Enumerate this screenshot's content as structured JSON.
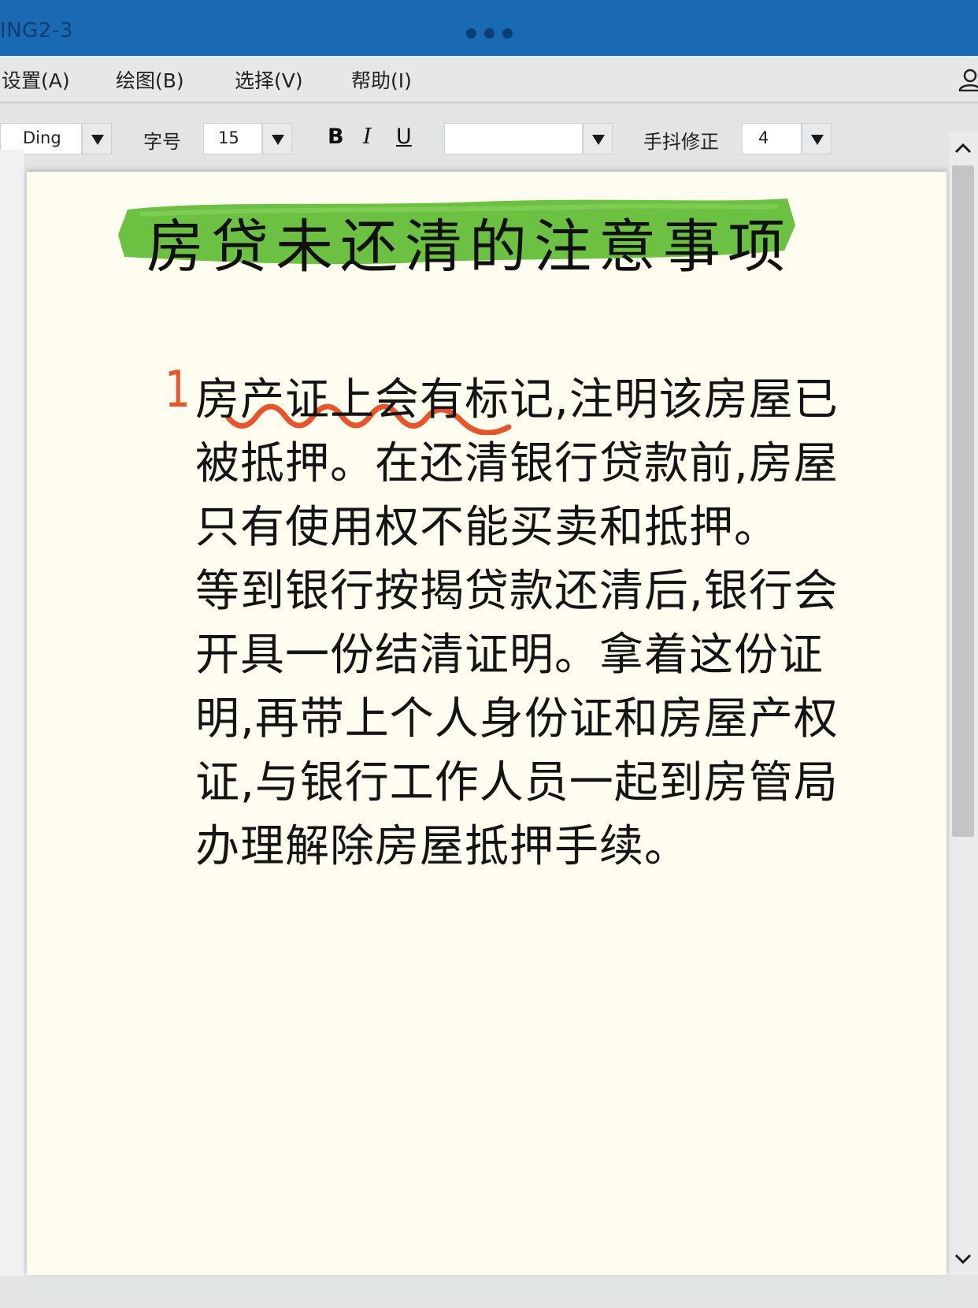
{
  "window": {
    "title": "ING2-3"
  },
  "menu": {
    "items": [
      "设置(A)",
      "绘图(B)",
      "选择(V)",
      "帮助(I)"
    ]
  },
  "toolbar": {
    "font_value": "Ding",
    "font_size_label": "字号",
    "font_size_value": "15",
    "bold": "B",
    "italic": "I",
    "underline": "U",
    "style_value": "",
    "smoothing_label": "手抖修正",
    "smoothing_value": "4"
  },
  "document": {
    "heading": "房贷未还清的注意事项",
    "item_number": "1",
    "lines": [
      "房产证上会有标记,注明该房屋已",
      "被抵押。在还清银行贷款前,房屋",
      "只有使用权不能买卖和抵押。",
      "等到银行按揭贷款还清后,银行会",
      "开具一份结清证明。拿着这份证",
      "明,再带上个人身份证和房屋产权",
      "证,与银行工作人员一起到房管局",
      "办理解除房屋抵押手续。"
    ]
  },
  "colors": {
    "titlebar": "#1a69b3",
    "highlight": "#6dc142",
    "accent": "#e4562b",
    "paper": "#fffdf0"
  },
  "icons": [
    "user-icon",
    "chevron-up-icon",
    "chevron-down-icon"
  ]
}
